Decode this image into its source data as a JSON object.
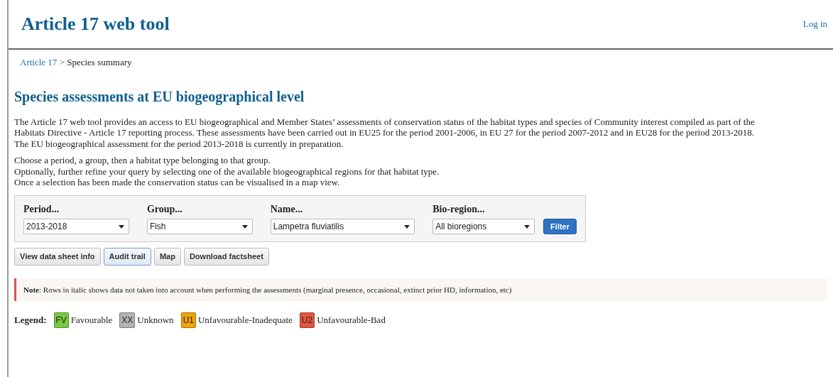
{
  "header": {
    "title": "Article 17 web tool",
    "login": "Log in"
  },
  "breadcrumb": {
    "link": "Article 17",
    "separator": ">",
    "current": "Species summary"
  },
  "heading": "Species assessments at EU biogeographical level",
  "intro": [
    "The Article 17 web tool provides an access to EU biogeographical and Member States’ assessments of conservation status of the habitat types and species of Community interest compiled as part of the",
    "Habitats Directive - Article 17 reporting process. These assessments have been carried out in EU25 for the period 2001-2006, in EU 27 for the period 2007-2012 and in EU28 for the period 2013-2018.",
    "The EU biogeographical assessment for the period 2013-2018 is currently in preparation."
  ],
  "instructions": [
    "Choose a period, a group, then a habitat type belonging to that group.",
    "Optionally, further refine your query by selecting one of the available biogeographical regions for that habitat type.",
    "Once a selection has been made the conservation status can be visualised in a map view."
  ],
  "filters": [
    {
      "label": "Period...",
      "value": "2013-2018"
    },
    {
      "label": "Group...",
      "value": "Fish"
    },
    {
      "label": "Name...",
      "value": "Lampetra fluviatilis"
    },
    {
      "label": "Bio-region...",
      "value": "All bioregions"
    }
  ],
  "filter_button": "Filter",
  "actions": [
    {
      "label": "View data sheet info",
      "selected": false
    },
    {
      "label": "Audit trail",
      "selected": true
    },
    {
      "label": "Map",
      "selected": false
    },
    {
      "label": "Download factsheet",
      "selected": false
    }
  ],
  "note": "**Note**: Rows in italic shows data not taken into account when performing the assessments (marginal presence, occasional, extinct prior HD, information, etc)",
  "legend": {
    "label": "Legend:",
    "items": [
      {
        "code": "FV",
        "text": "Favourable",
        "color": "#7ac943"
      },
      {
        "code": "XX",
        "text": "Unknown",
        "color": "#b3b3b3"
      },
      {
        "code": "U1",
        "text": "Unfavourable-Inadequate",
        "color": "#f0a30a"
      },
      {
        "code": "U2",
        "text": "Unfavourable-Bad",
        "color": "#e4553f"
      }
    ]
  }
}
